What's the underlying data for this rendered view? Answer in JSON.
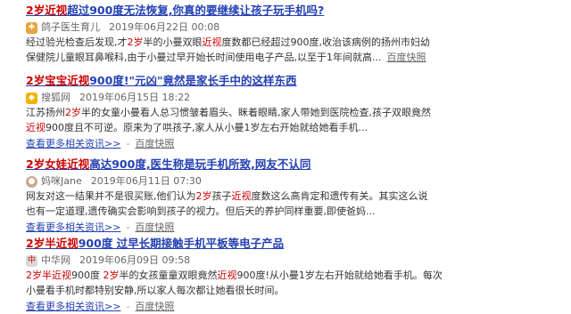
{
  "results": [
    {
      "title_parts": [
        "2岁",
        "近视",
        "超过900度无法恢复,你真的要继续让孩子玩手机吗?"
      ],
      "source": "鸽子医生育儿",
      "source_icon": "hospital-icon",
      "date": "2019年06月22日 00:08",
      "lines": [
        [
          "经过验光检查后发现,才",
          "2岁",
          "半的小曼双眼",
          "近视",
          "度数都已经超过900度,收治该病例的扬州市妇幼"
        ],
        [
          "保健院儿童眼耳鼻喉科,由于小曼过早开始长时间使用电子产品,以至于1年间就高...",
          "",
          "",
          "",
          ""
        ]
      ],
      "snapshot": "百度快照",
      "more_link": "",
      "snapshot2": ""
    },
    {
      "title_parts": [
        "2岁",
        "宝宝",
        "近视",
        "900度!\"元凶\"竟然是家长手中的这样东西"
      ],
      "source": "搜狐网",
      "source_icon": "sohu-icon",
      "date": "2019年06月15日 18:22",
      "lines": [
        [
          "江苏扬州",
          "2岁",
          "半的女童小曼看人总习惯皱着眉头、眯着眼睛,家人带她到医院检查,孩子双眼竟然"
        ],
        [
          "近视",
          "900度且不可逆。原来为了哄孩子,家人从小曼1岁左右开始就给她看手机..."
        ]
      ],
      "snapshot": "",
      "more_link": "查看更多相关资讯>>",
      "snapshot2": "百度快照"
    },
    {
      "title_parts": [
        "2岁",
        "女娃",
        "近视",
        "高达900度,医生称是玩手机所致,网友不认同"
      ],
      "source": "妈咪Jane",
      "source_icon": "avatar-icon",
      "date": "2019年06月11日 07:30",
      "lines": [
        [
          "网友对这一结果并不是很买账,他们认为",
          "2岁",
          "孩子",
          "近视",
          "度数这么高肯定和遗传有关。其实这么说"
        ],
        [
          "也有一定道理,遗传确实会影响到孩子的视力。但后天的养护同样重要,即使爸妈..."
        ]
      ],
      "snapshot": "",
      "more_link": "查看更多相关资讯>>",
      "snapshot2": "百度快照"
    },
    {
      "title_parts": [
        "2岁",
        "半",
        "近视",
        "900度 过早长期接触手机平板等电子产品"
      ],
      "source": "中华网",
      "source_icon": "china-icon",
      "date": "2019年06月09日 09:58",
      "lines": [
        [
          "2岁",
          "半",
          "近视",
          "900度 ",
          "2岁",
          "半的女孩童童双眼竟然",
          "近视",
          "900度!从小曼1岁左右开始就给她看手机。每次"
        ],
        [
          "小曼看手机时都特别安静,所以家人每次都让她看很长时间。"
        ]
      ],
      "snapshot": "",
      "more_link": "查看更多相关资讯>>",
      "snapshot2": "百度快照"
    }
  ],
  "colors": {
    "title": "#2440b3",
    "highlight": "#cc0000",
    "meta": "#666666"
  }
}
